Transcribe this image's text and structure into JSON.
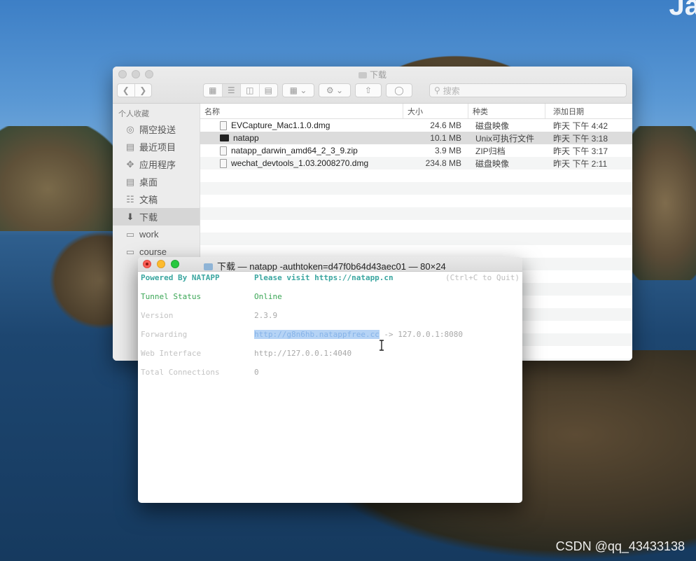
{
  "desktop": {
    "corner_text": "Ja",
    "watermark": "CSDN @qq_43433138"
  },
  "finder": {
    "title": "下载",
    "search_placeholder": "搜索",
    "sidebar": {
      "section_title": "个人收藏",
      "items": [
        {
          "label": "隔空投送",
          "icon": "airdrop-icon"
        },
        {
          "label": "最近项目",
          "icon": "recents-icon"
        },
        {
          "label": "应用程序",
          "icon": "applications-icon"
        },
        {
          "label": "桌面",
          "icon": "desktop-icon"
        },
        {
          "label": "文稿",
          "icon": "documents-icon"
        },
        {
          "label": "下载",
          "icon": "downloads-icon"
        },
        {
          "label": "work",
          "icon": "folder-icon"
        },
        {
          "label": "course",
          "icon": "folder-icon"
        }
      ]
    },
    "columns": {
      "name": "名称",
      "size": "大小",
      "kind": "种类",
      "date": "添加日期"
    },
    "files": [
      {
        "name": "EVCapture_Mac1.1.0.dmg",
        "size": "24.6 MB",
        "kind": "磁盘映像",
        "date": "昨天 下午 4:42"
      },
      {
        "name": "natapp",
        "size": "10.1 MB",
        "kind": "Unix可执行文件",
        "date": "昨天 下午 3:18"
      },
      {
        "name": "natapp_darwin_amd64_2_3_9.zip",
        "size": "3.9 MB",
        "kind": "ZIP归档",
        "date": "昨天 下午 3:17"
      },
      {
        "name": "wechat_devtools_1.03.2008270.dmg",
        "size": "234.8 MB",
        "kind": "磁盘映像",
        "date": "昨天 下午 2:11"
      }
    ]
  },
  "terminal": {
    "title": "下载 — natapp -authtoken=d47f0b64d43aec01 — 80×24",
    "header_left": "Powered By NATAPP",
    "header_mid": "Please visit https://natapp.cn",
    "header_right": "(Ctrl+C to Quit)",
    "rows": [
      {
        "label": "Tunnel Status",
        "value": "Online"
      },
      {
        "label": "Version",
        "value": "2.3.9"
      },
      {
        "label": "Forwarding",
        "value_selected": "http://g8n6hb.natappfree.cc",
        "value_rest": " -> 127.0.0.1:8080"
      },
      {
        "label": "Web Interface",
        "value": "http://127.0.0.1:4040"
      },
      {
        "label": "Total Connections",
        "value": "0"
      }
    ]
  }
}
